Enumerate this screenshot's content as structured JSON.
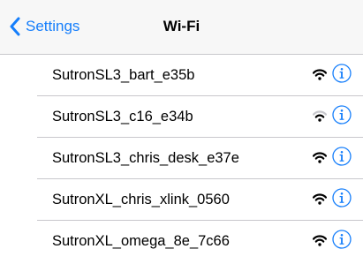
{
  "navbar": {
    "back_label": "Settings",
    "title": "Wi-Fi"
  },
  "networks": [
    {
      "name": "SutronSL3_bart_e35b",
      "signal": "full"
    },
    {
      "name": "SutronSL3_c16_e34b",
      "signal": "medium"
    },
    {
      "name": "SutronSL3_chris_desk_e37e",
      "signal": "full"
    },
    {
      "name": "SutronXL_chris_xlink_0560",
      "signal": "full"
    },
    {
      "name": "SutronXL_omega_8e_7c66",
      "signal": "full"
    }
  ],
  "icons": {
    "back": "chevron-left-icon",
    "wifi": "wifi-icon",
    "info": "info-icon"
  },
  "colors": {
    "accent": "#157efb",
    "navbar_bg": "#f7f7f7",
    "separator": "#c8c7cc"
  }
}
